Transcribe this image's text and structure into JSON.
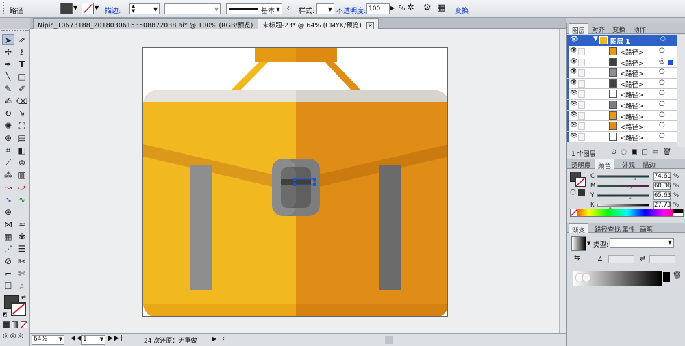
{
  "control_bar": {
    "object_type": "路径",
    "stroke_label": "描边:",
    "stroke_profile": "基本",
    "style_label": "样式:",
    "opacity_label": "不透明度:",
    "opacity_value": "100",
    "opacity_unit": "%",
    "transform_label": "变换"
  },
  "tabs": [
    {
      "label": "Nipic_10673188_20180306153508872038.ai* @ 100% (RGB/预览)",
      "active": false
    },
    {
      "label": "未标题-23* @ 64% (CMYK/预览)",
      "active": true
    }
  ],
  "status": {
    "zoom": "64%",
    "page": "1",
    "undo_text": "24 次还原：无重做"
  },
  "layers_panel": {
    "tabs": [
      "图层",
      "对齐",
      "变换",
      "动作"
    ],
    "layer_name": "图层 1",
    "items": [
      "<路径>",
      "<路径>",
      "<路径>",
      "<路径>",
      "<路径>",
      "<路径>",
      "<路径>",
      "<路径>",
      "<路径>"
    ],
    "footer": "1 个图层"
  },
  "color_panel": {
    "tabs": [
      "透明度",
      "颜色",
      "外观",
      "描边"
    ],
    "channels": [
      {
        "name": "C",
        "value": "74.61",
        "pct": "%"
      },
      {
        "name": "M",
        "value": "68.36",
        "pct": "%"
      },
      {
        "name": "Y",
        "value": "65.63",
        "pct": "%"
      },
      {
        "name": "K",
        "value": "27.73",
        "pct": "%"
      }
    ]
  },
  "gradient_panel": {
    "tabs": [
      "渐变",
      "路径查找",
      "属性",
      "画笔"
    ],
    "type_label": "类型:"
  },
  "colors": {
    "bag_left": "#f2b81f",
    "bag_right": "#df8d16",
    "strap": "#8e8e8e",
    "strap_dark": "#6b6b6b",
    "lid": "#e6e3de",
    "fill_swatch": "#404040",
    "accent_blue": "#1558d6"
  }
}
